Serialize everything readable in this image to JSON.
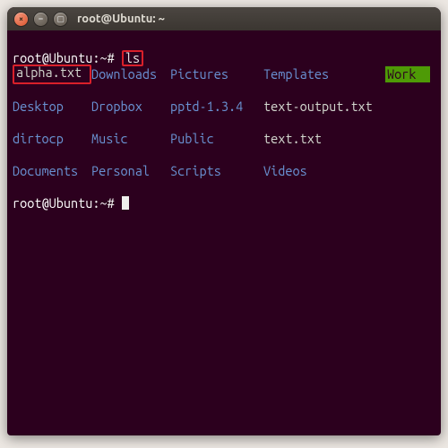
{
  "window": {
    "title": "root@Ubuntu: ~",
    "buttons": {
      "close": "×",
      "min": "–",
      "max": "▢"
    }
  },
  "prompt": {
    "user_host": "root@Ubuntu",
    "sep1": ":",
    "path": "~",
    "sigil": "#"
  },
  "command": "ls",
  "listing": {
    "rows": [
      [
        {
          "name": "alpha.txt",
          "kind": "file",
          "annot": "red"
        },
        {
          "name": "Downloads",
          "kind": "dir"
        },
        {
          "name": "Pictures",
          "kind": "dir"
        },
        {
          "name": "Templates",
          "kind": "dir"
        },
        {
          "name": "Work",
          "kind": "odd",
          "annot": "green"
        }
      ],
      [
        {
          "name": "Desktop",
          "kind": "dir"
        },
        {
          "name": "Dropbox",
          "kind": "dir"
        },
        {
          "name": "pptd-1.3.4",
          "kind": "dir"
        },
        {
          "name": "text-output.txt",
          "kind": "file"
        }
      ],
      [
        {
          "name": "dirtocp",
          "kind": "dir"
        },
        {
          "name": "Music",
          "kind": "dir"
        },
        {
          "name": "Public",
          "kind": "dir"
        },
        {
          "name": "text.txt",
          "kind": "file"
        }
      ],
      [
        {
          "name": "Documents",
          "kind": "dir"
        },
        {
          "name": "Personal",
          "kind": "dir"
        },
        {
          "name": "Scripts",
          "kind": "dir"
        },
        {
          "name": "Videos",
          "kind": "dir"
        }
      ]
    ]
  },
  "colors": {
    "terminal_bg": "#2c001e",
    "text": "#eeeeec",
    "dir": "#6a93d4",
    "file": "#d3d7cf",
    "odd": "#ad7fa8",
    "highlight_green": "#4e9a06",
    "annotation_red": "#d9202a"
  }
}
